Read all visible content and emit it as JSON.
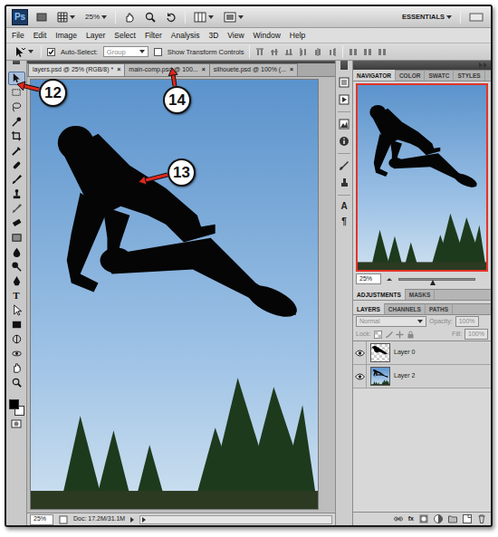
{
  "app_bar": {
    "logo": "Ps",
    "zoom": "25%",
    "workspace": "ESSENTIALS"
  },
  "menu": [
    "File",
    "Edit",
    "Image",
    "Layer",
    "Select",
    "Filter",
    "Analysis",
    "3D",
    "View",
    "Window",
    "Help"
  ],
  "options_bar": {
    "auto_select": {
      "label": "Auto-Select:",
      "checked": true
    },
    "target": "Group",
    "transform_controls": {
      "label": "Show Transform Controls",
      "checked": false
    }
  },
  "tools": [
    {
      "selected": true
    },
    {
      "selected": false
    },
    {
      "selected": false
    },
    {
      "selected": false
    },
    {
      "selected": false
    },
    {
      "selected": false
    },
    {
      "selected": false
    },
    {
      "selected": false
    },
    {
      "selected": false
    },
    {
      "selected": false
    },
    {
      "selected": false
    },
    {
      "selected": false
    },
    {
      "selected": false
    },
    {
      "selected": false
    },
    {
      "selected": false
    },
    {
      "selected": false,
      "glyph": "T"
    },
    {
      "selected": false
    },
    {
      "selected": false
    },
    {
      "selected": false
    },
    {
      "selected": false
    },
    {
      "selected": false
    },
    {
      "selected": false
    }
  ],
  "doc_tabs": [
    {
      "label": "layers.psd @ 25% (RGB/8) *",
      "close": "×",
      "selected": true
    },
    {
      "label": "main-comp.psd @ 100...",
      "close": "×",
      "selected": false
    },
    {
      "label": "silhouete.psd @ 100% (...",
      "close": "×",
      "selected": false
    }
  ],
  "callouts": [
    {
      "number": "12"
    },
    {
      "number": "13"
    },
    {
      "number": "14"
    }
  ],
  "icon_column_glyphs": [
    "A",
    "¶"
  ],
  "panels": {
    "top_tabs": [
      {
        "label": "NAVIGATOR",
        "selected": true
      },
      {
        "label": "COLOR",
        "selected": false
      },
      {
        "label": "SWATC",
        "selected": false
      },
      {
        "label": "STYLES",
        "selected": false
      }
    ],
    "navigator": {
      "zoom": "25%",
      "level": 0.45
    },
    "mid_tabs": [
      {
        "label": "ADJUSTMENTS",
        "selected": true
      },
      {
        "label": "MASKS",
        "selected": false
      }
    ],
    "layer_tabs": [
      {
        "label": "LAYERS",
        "selected": true
      },
      {
        "label": "CHANNELS",
        "selected": false
      },
      {
        "label": "PATHS",
        "selected": false
      }
    ],
    "blend_mode": "Normal",
    "opacity": {
      "label": "Opacity:",
      "value": "100%",
      "disabled": true
    },
    "lock": {
      "label": "Lock:"
    },
    "fill": {
      "label": "Fill:",
      "value": "100%",
      "disabled": true
    },
    "layers": [
      {
        "name": "Layer 0",
        "kind": "cutout",
        "visible": true,
        "selected": false
      },
      {
        "name": "Layer 2",
        "kind": "photo",
        "visible": true,
        "selected": false
      }
    ],
    "footer_glyph": "fx"
  },
  "status_bar": {
    "zoom": "25%",
    "doc": "Doc: 17.2M/31.1M"
  }
}
